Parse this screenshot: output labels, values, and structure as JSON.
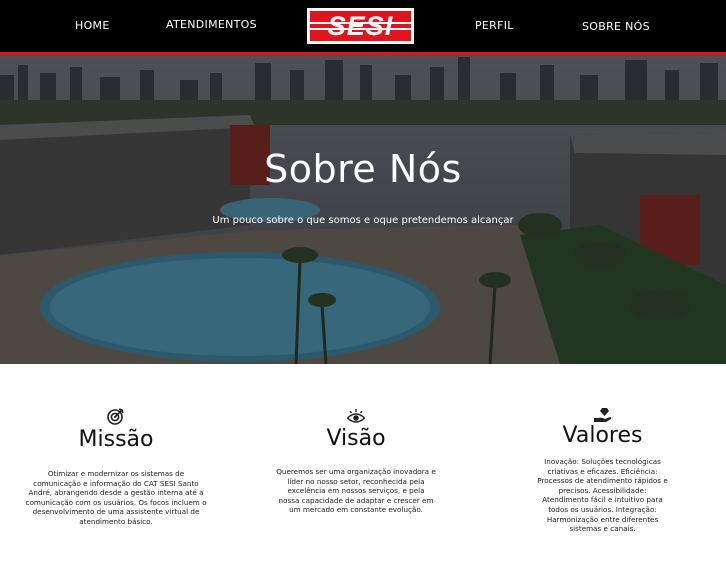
{
  "nav": {
    "home": "HOME",
    "atendimentos": "ATENDIMENTOS",
    "perfil": "PERFIL",
    "sobre": "SOBRE NÓS",
    "logo_text": "SESI"
  },
  "hero": {
    "title": "Sobre Nós",
    "subtitle": "Um pouco sobre o que somos e oque pretendemos alcançar"
  },
  "cards": [
    {
      "icon": "target-icon",
      "title": "Missão",
      "text": "Otimizar e modernizar os sistemas de comunicação e informação do CAT SESI Santo André, abrangendo desde a gestão interna até a comunicação com os usuários. Os focos incluem o desenvolvimento de uma assistente virtual de atendimento básico."
    },
    {
      "icon": "eye-icon",
      "title": "Visão",
      "text": "Queremos ser uma organização inovadora e líder no nosso setor, reconhecida pela excelência em nossos serviços, e pela nossa capacidade de adaptar e crescer em um mercado em constante evolução."
    },
    {
      "icon": "hand-gem-icon",
      "title": "Valores",
      "text": "Inovação: Soluções tecnológicas criativas e eficazes. Eficiência: Processos de atendimento rápidos e precisos. Acessibilidade: Atendimento fácil e intuitivo para todos os usuários. Integração: Harmonização entre diferentes sistemas e canais."
    }
  ],
  "colors": {
    "brand_red": "#e0141e",
    "nav_bg": "#000000"
  }
}
